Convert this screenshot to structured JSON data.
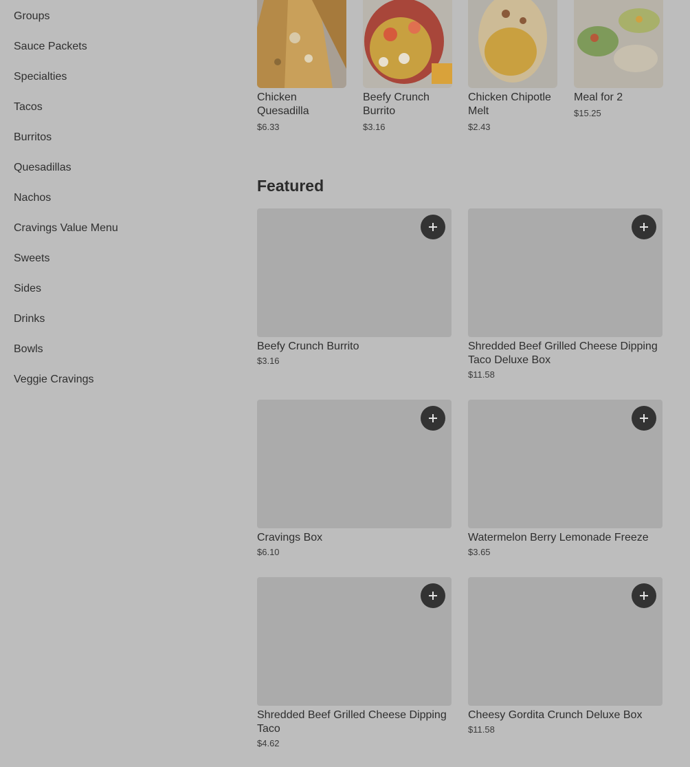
{
  "sidebar": {
    "items": [
      {
        "label": "Groups"
      },
      {
        "label": "Sauce Packets"
      },
      {
        "label": "Specialties"
      },
      {
        "label": "Tacos"
      },
      {
        "label": "Burritos"
      },
      {
        "label": "Quesadillas"
      },
      {
        "label": "Nachos"
      },
      {
        "label": "Cravings Value Menu"
      },
      {
        "label": "Sweets"
      },
      {
        "label": "Sides"
      },
      {
        "label": "Drinks"
      },
      {
        "label": "Bowls"
      },
      {
        "label": "Veggie Cravings"
      }
    ]
  },
  "carousel": {
    "items": [
      {
        "name": "Chicken Quesadilla",
        "price": "$6.33"
      },
      {
        "name": "Beefy Crunch Burrito",
        "price": "$3.16"
      },
      {
        "name": "Chicken Chipotle Melt",
        "price": "$2.43"
      },
      {
        "name": "Meal for 2",
        "price": "$15.25"
      }
    ]
  },
  "featured": {
    "title": "Featured",
    "items": [
      {
        "name": "Beefy Crunch Burrito",
        "price": "$3.16"
      },
      {
        "name": "Shredded Beef Grilled Cheese Dipping Taco Deluxe Box",
        "price": "$11.58"
      },
      {
        "name": "Cravings Box",
        "price": "$6.10"
      },
      {
        "name": "Watermelon Berry Lemonade Freeze",
        "price": "$3.65"
      },
      {
        "name": "Shredded Beef Grilled Cheese Dipping Taco",
        "price": "$4.62"
      },
      {
        "name": "Cheesy Gordita Crunch Deluxe Box",
        "price": "$11.58"
      }
    ]
  },
  "icons": {
    "add": "plus-icon"
  },
  "colors": {
    "background": "#bdbdbd",
    "placeholder": "#ababab",
    "add_button": "#333333"
  }
}
